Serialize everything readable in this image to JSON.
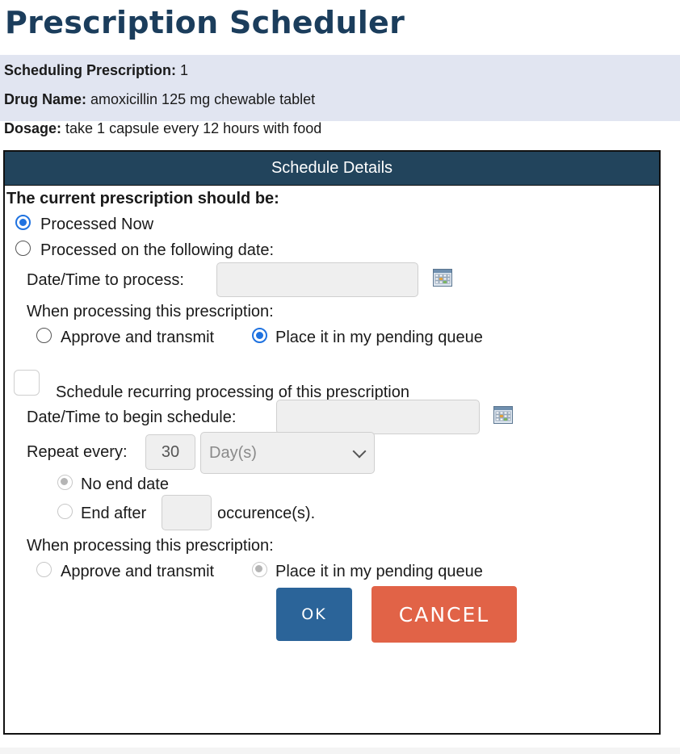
{
  "page": {
    "title": "Prescription Scheduler"
  },
  "info": {
    "scheduling_label": "Scheduling Prescription:",
    "scheduling_value": "1",
    "drug_label": "Drug Name:",
    "drug_value": "amoxicillin 125 mg chewable tablet",
    "dosage_label": "Dosage:",
    "dosage_value": "take 1 capsule every 12 hours with food"
  },
  "panel": {
    "header": "Schedule Details",
    "question": "The current prescription should be:",
    "options": {
      "now": {
        "label": "Processed Now",
        "checked": true
      },
      "date": {
        "label": "Processed on the following date:",
        "checked": false
      }
    },
    "date_time_label": "Date/Time to process:",
    "date_time_value": "",
    "when_processing_label": "When processing this prescription:",
    "approve_label": "Approve and transmit",
    "pending_label": "Place it in my pending queue",
    "recurring": {
      "checkbox_label": "Schedule recurring processing of this prescription",
      "checked": false,
      "begin_label": "Date/Time to begin schedule:",
      "begin_value": "",
      "repeat_label": "Repeat every:",
      "repeat_value": "30",
      "repeat_unit": "Day(s)",
      "no_end_label": "No end date",
      "end_after_label": "End after",
      "end_after_value": "",
      "occurrences_label": "occurence(s).",
      "when_processing_label": "When processing this prescription:",
      "approve_label": "Approve and transmit",
      "pending_label": "Place it in my pending queue"
    },
    "buttons": {
      "ok": "OK",
      "cancel": "CANCEL"
    }
  },
  "colors": {
    "title": "#1b3d5c",
    "header_bg": "#22445c",
    "info_band": "#e1e5f1",
    "radio_selected": "#1f72e0",
    "ok_button": "#2b6499",
    "cancel_button": "#e16347"
  },
  "icons": {
    "calendar": "calendar-icon",
    "dropdown": "chevron-down-icon"
  }
}
